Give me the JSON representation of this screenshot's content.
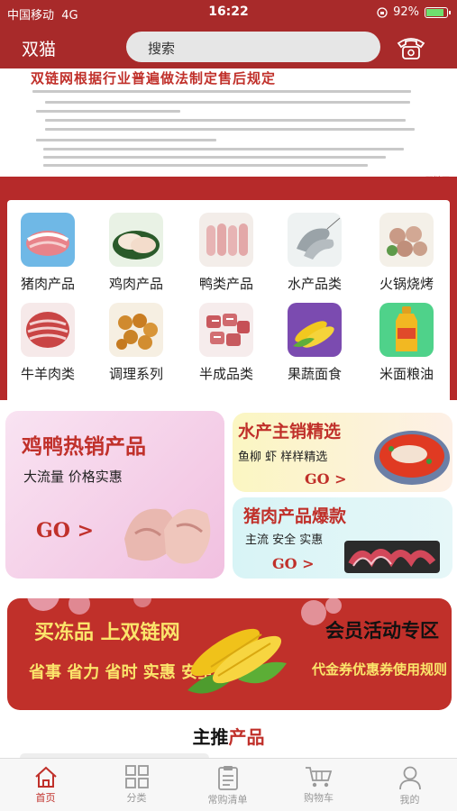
{
  "status": {
    "carrier": "中国移动",
    "network": "4G",
    "time": "16:22",
    "battery": "92%",
    "battery_level": 0.92
  },
  "header": {
    "title": "双猫",
    "search_placeholder": "搜索"
  },
  "notice": {
    "title": "双链网根据行业普遍做法制定售后规定",
    "logo_text": "双链网"
  },
  "categories": [
    {
      "label": "猪肉产品",
      "icon": "pork-icon"
    },
    {
      "label": "鸡肉产品",
      "icon": "chicken-icon"
    },
    {
      "label": "鸭类产品",
      "icon": "duck-icon"
    },
    {
      "label": "水产品类",
      "icon": "shrimp-icon"
    },
    {
      "label": "火锅烧烤",
      "icon": "meatball-icon"
    },
    {
      "label": "牛羊肉类",
      "icon": "beef-roll-icon"
    },
    {
      "label": "调理系列",
      "icon": "fried-chicken-icon"
    },
    {
      "label": "半成品类",
      "icon": "ribs-icon"
    },
    {
      "label": "果蔬面食",
      "icon": "corn-icon"
    },
    {
      "label": "米面粮油",
      "icon": "oil-icon"
    }
  ],
  "promos": {
    "duck": {
      "title": "鸡鸭热销产品",
      "subtitle": "大流量 价格实惠",
      "go": "GO >"
    },
    "aqua": {
      "title": "水产主销精选",
      "subtitle": "鱼柳 虾 样样精选",
      "go": "GO >"
    },
    "pork": {
      "title": "猪肉产品爆款",
      "subtitle": "主流 安全 实惠",
      "go": "GO >"
    }
  },
  "member": {
    "slogan": "买冻品  上双链网",
    "benefits": "省事 省力 省时 实惠 安全",
    "zone": "会员活动专区",
    "rules": "代金券优惠券使用规则"
  },
  "section": {
    "prefix": "主推",
    "highlight": "产品"
  },
  "tabs": [
    {
      "label": "首页",
      "icon": "home-icon",
      "active": true
    },
    {
      "label": "分类",
      "icon": "category-grid-icon",
      "active": false
    },
    {
      "label": "常购清单",
      "icon": "clipboard-icon",
      "active": false
    },
    {
      "label": "购物车",
      "icon": "cart-icon",
      "active": false
    },
    {
      "label": "我的",
      "icon": "user-icon",
      "active": false
    }
  ],
  "colors": {
    "brand": "#a82a2a",
    "accent": "#c0302a",
    "gold": "#fbe56b"
  }
}
